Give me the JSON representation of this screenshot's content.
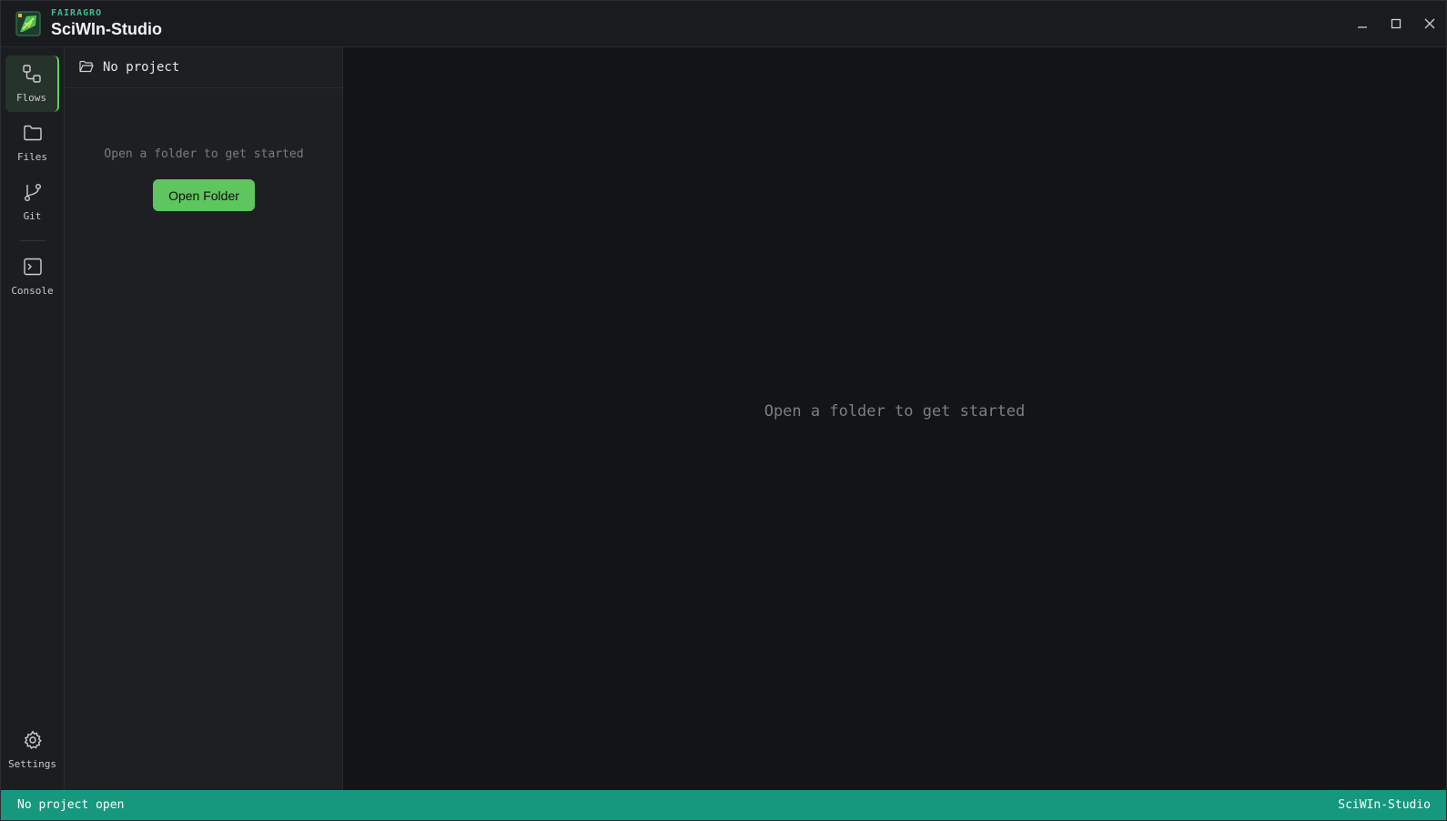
{
  "titlebar": {
    "brand_small": "FAIRAGRO",
    "app_title": "SciWIn-Studio",
    "minimize_icon": "minimize-icon",
    "maximize_icon": "maximize-icon",
    "close_icon": "close-icon"
  },
  "activity_bar": {
    "items": [
      {
        "label": "Flows",
        "icon": "flows-icon",
        "active": true
      },
      {
        "label": "Files",
        "icon": "folder-icon",
        "active": false
      },
      {
        "label": "Git",
        "icon": "git-branch-icon",
        "active": false
      },
      {
        "label": "Console",
        "icon": "terminal-icon",
        "active": false
      }
    ],
    "settings": {
      "label": "Settings",
      "icon": "gear-icon"
    }
  },
  "sidebar": {
    "project_label": "No project",
    "empty_message": "Open a folder to get started",
    "open_folder_label": "Open Folder"
  },
  "main": {
    "empty_message": "Open a folder to get started"
  },
  "statusbar": {
    "left_text": "No project open",
    "right_text": "SciWIn-Studio"
  },
  "colors": {
    "accent_green": "#5fc55f",
    "status_teal": "#16987f",
    "brand_teal": "#3dbd8e"
  }
}
